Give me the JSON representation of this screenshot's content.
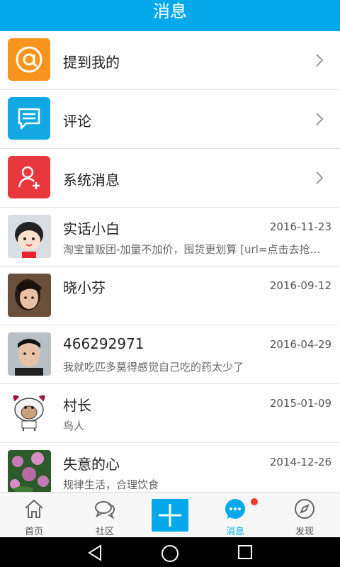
{
  "header": {
    "title": "消息"
  },
  "system_items": [
    {
      "label": "提到我的",
      "icon": "at-icon",
      "color": "#f7941d"
    },
    {
      "label": "评论",
      "icon": "comment-icon",
      "color": "#13a8e3"
    },
    {
      "label": "系统消息",
      "icon": "user-add-icon",
      "color": "#e8383d"
    }
  ],
  "conversations": [
    {
      "name": "实话小白",
      "date": "2016-11-23",
      "preview": "淘宝量贩团-加量不加价，囤货更划算 [url=点击去抢…"
    },
    {
      "name": "晓小芬",
      "date": "2016-09-12",
      "preview": ""
    },
    {
      "name": "466292971",
      "date": "2016-04-29",
      "preview": "我就吃匹多莫得感觉自己吃的药太少了"
    },
    {
      "name": "村长",
      "date": "2015-01-09",
      "preview": "鸟人"
    },
    {
      "name": "失意的心",
      "date": "2014-12-26",
      "preview": "规律生活，合理饮食"
    }
  ],
  "tabbar": {
    "tabs": [
      {
        "label": "首页",
        "icon": "home-icon"
      },
      {
        "label": "社区",
        "icon": "community-icon"
      },
      {
        "label": "",
        "icon": "plus-icon"
      },
      {
        "label": "消息",
        "icon": "message-icon",
        "active": true
      },
      {
        "label": "发现",
        "icon": "compass-icon"
      }
    ]
  },
  "colors": {
    "accent": "#03a9ea",
    "badge": "#f03c2c"
  }
}
